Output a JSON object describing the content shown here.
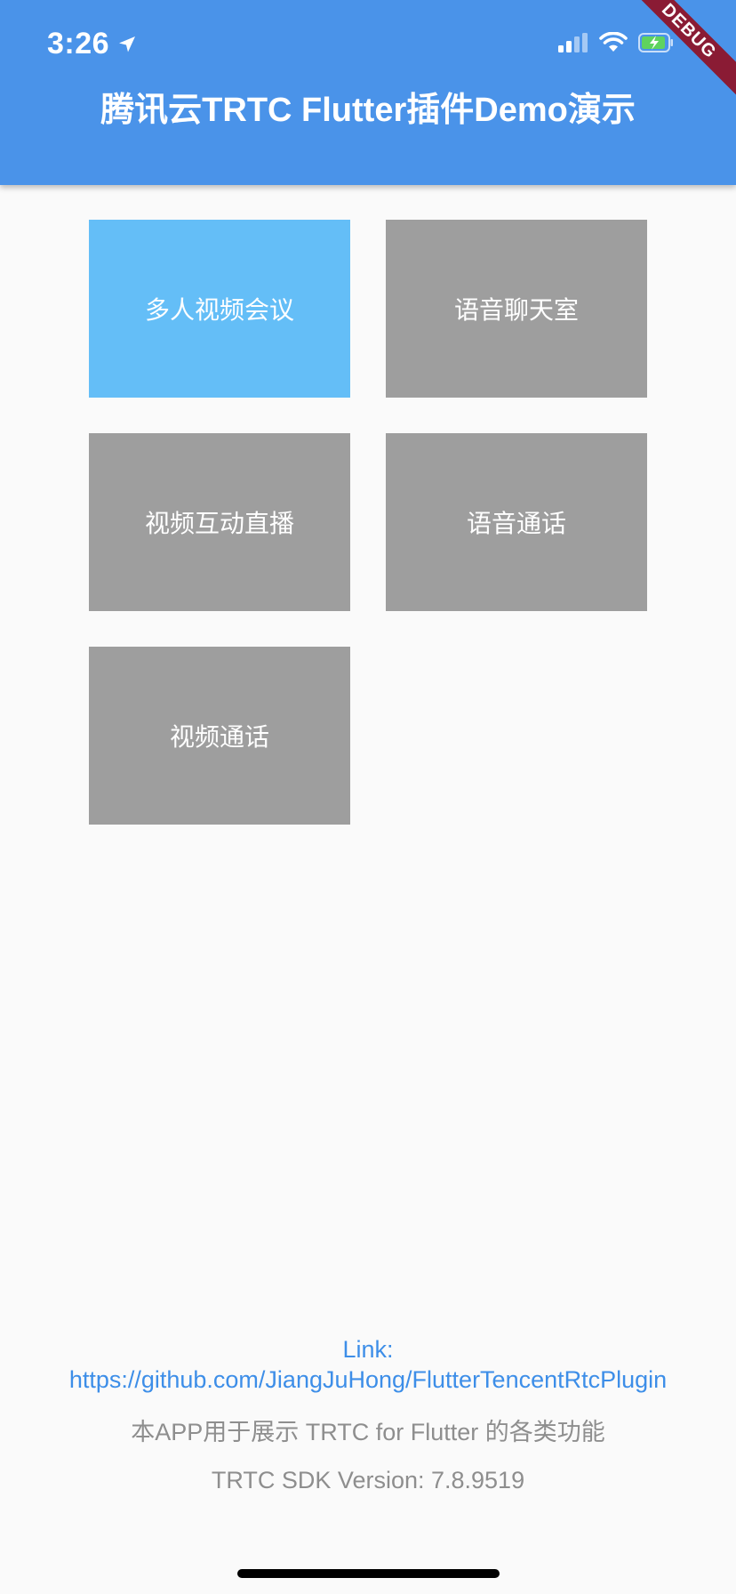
{
  "status_bar": {
    "time": "3:26",
    "icons": [
      "location-arrow-icon",
      "cellular-signal-icon",
      "wifi-icon",
      "battery-charging-icon"
    ]
  },
  "debug_banner": "DEBUG",
  "app_bar": {
    "title": "腾讯云TRTC Flutter插件Demo演示"
  },
  "menu": {
    "items": [
      {
        "label": "多人视频会议",
        "active": true
      },
      {
        "label": "语音聊天室",
        "active": false
      },
      {
        "label": "视频互动直播",
        "active": false
      },
      {
        "label": "语音通话",
        "active": false
      },
      {
        "label": "视频通话",
        "active": false
      }
    ]
  },
  "footer": {
    "link_label": "Link:",
    "link_url": "https://github.com/JiangJuHong/FlutterTencentRtcPlugin",
    "description": "本APP用于展示 TRTC for Flutter 的各类功能",
    "version": "TRTC SDK Version: 7.8.9519"
  },
  "colors": {
    "appbar": "#4a93e9",
    "tile_active": "#64bef7",
    "tile_default": "#9e9e9e",
    "link": "#3d8ee8",
    "debug_banner": "#8a1b34"
  }
}
